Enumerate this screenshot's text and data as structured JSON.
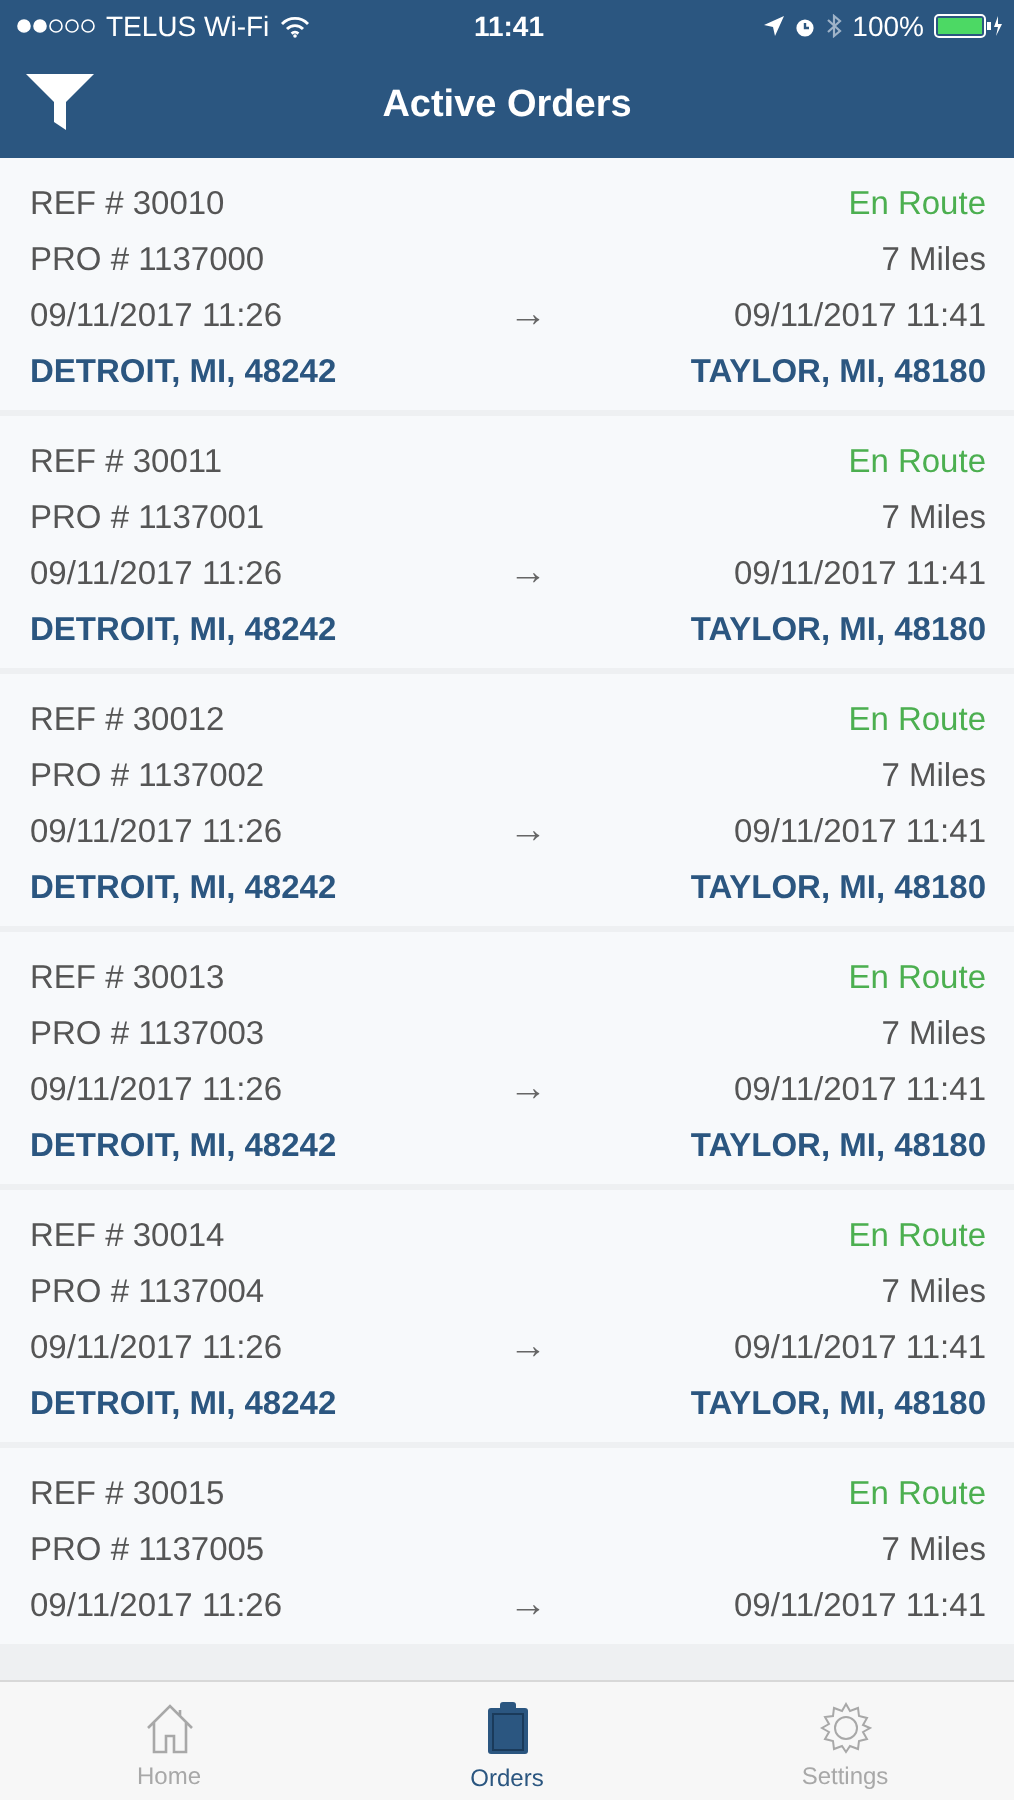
{
  "status_bar": {
    "carrier": "TELUS Wi-Fi",
    "time": "11:41",
    "battery": "100%"
  },
  "nav": {
    "title": "Active Orders"
  },
  "orders": [
    {
      "ref": "REF # 30010",
      "status": "En Route",
      "pro": "PRO # 1137000",
      "distance": "7 Miles",
      "pickup_time": "09/11/2017 11:26",
      "arrow": "→",
      "drop_time": "09/11/2017 11:41",
      "origin": "DETROIT, MI, 48242",
      "destination": "TAYLOR, MI, 48180"
    },
    {
      "ref": "REF # 30011",
      "status": "En Route",
      "pro": "PRO # 1137001",
      "distance": "7 Miles",
      "pickup_time": "09/11/2017 11:26",
      "arrow": "→",
      "drop_time": "09/11/2017 11:41",
      "origin": "DETROIT, MI, 48242",
      "destination": "TAYLOR, MI, 48180"
    },
    {
      "ref": "REF # 30012",
      "status": "En Route",
      "pro": "PRO # 1137002",
      "distance": "7 Miles",
      "pickup_time": "09/11/2017 11:26",
      "arrow": "→",
      "drop_time": "09/11/2017 11:41",
      "origin": "DETROIT, MI, 48242",
      "destination": "TAYLOR, MI, 48180"
    },
    {
      "ref": "REF # 30013",
      "status": "En Route",
      "pro": "PRO # 1137003",
      "distance": "7 Miles",
      "pickup_time": "09/11/2017 11:26",
      "arrow": "→",
      "drop_time": "09/11/2017 11:41",
      "origin": "DETROIT, MI, 48242",
      "destination": "TAYLOR, MI, 48180"
    },
    {
      "ref": "REF # 30014",
      "status": "En Route",
      "pro": "PRO # 1137004",
      "distance": "7 Miles",
      "pickup_time": "09/11/2017 11:26",
      "arrow": "→",
      "drop_time": "09/11/2017 11:41",
      "origin": "DETROIT, MI, 48242",
      "destination": "TAYLOR, MI, 48180"
    },
    {
      "ref": "REF # 30015",
      "status": "En Route",
      "pro": "PRO # 1137005",
      "distance": "7 Miles",
      "pickup_time": "09/11/2017 11:26",
      "arrow": "→",
      "drop_time": "09/11/2017 11:41"
    }
  ],
  "tab_bar": [
    {
      "label": "Home",
      "kind": "home",
      "selected": false
    },
    {
      "label": "Orders",
      "kind": "orders",
      "selected": true
    },
    {
      "label": "Settings",
      "kind": "settings",
      "selected": false
    }
  ]
}
